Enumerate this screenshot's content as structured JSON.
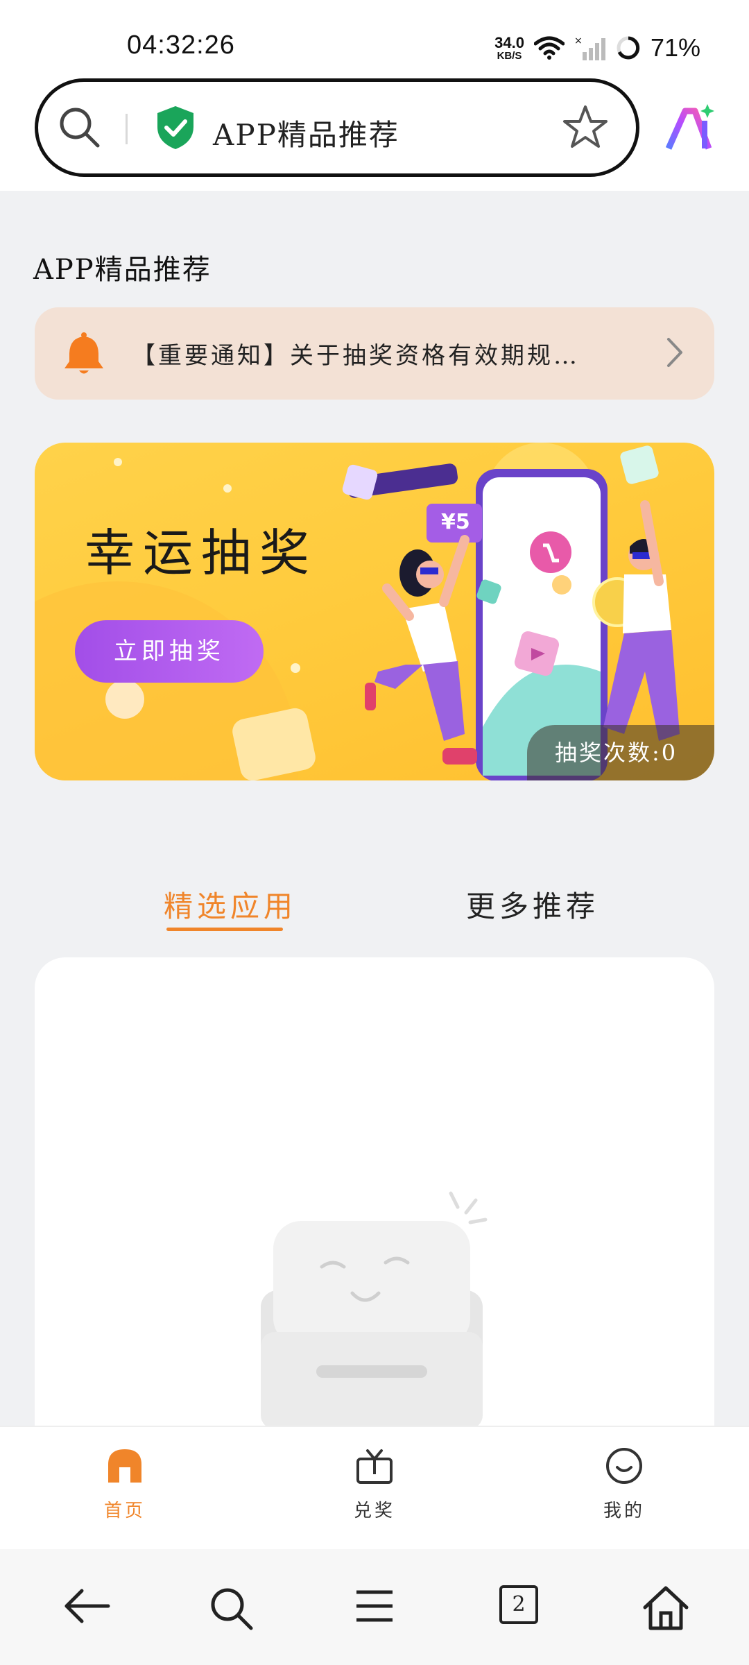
{
  "status_bar": {
    "time": "04:32:26",
    "net_speed_value": "34.0",
    "net_speed_unit": "KB/S",
    "battery": "71%"
  },
  "address_bar": {
    "title": "APP精品推荐",
    "icons": [
      "search-icon",
      "shield-check-icon",
      "star-icon",
      "ai-assistant-icon"
    ]
  },
  "page": {
    "heading": "APP精品推荐"
  },
  "notice": {
    "text": "【重要通知】关于抽奖资格有效期规…"
  },
  "banner": {
    "title": "幸运抽奖",
    "button_label": "立即抽奖",
    "price_tag": "¥5",
    "draw_count": "抽奖次数:0"
  },
  "tabs": [
    {
      "label": "精选应用",
      "active": true
    },
    {
      "label": "更多推荐",
      "active": false
    }
  ],
  "bottom_nav": [
    {
      "label": "首页",
      "icon": "home-icon",
      "active": true
    },
    {
      "label": "兑奖",
      "icon": "prize-box-icon",
      "active": false
    },
    {
      "label": "我的",
      "icon": "smile-icon",
      "active": false
    }
  ],
  "browser_bar": {
    "tab_count": "2",
    "icons": [
      "back-icon",
      "search-icon",
      "menu-icon",
      "tabs-icon",
      "home-icon"
    ]
  },
  "colors": {
    "accent": "#f0852a",
    "banner_yellow": "#ffcb3d",
    "button_purple": "#b05cee",
    "notice_bg": "#f3e1d5"
  }
}
